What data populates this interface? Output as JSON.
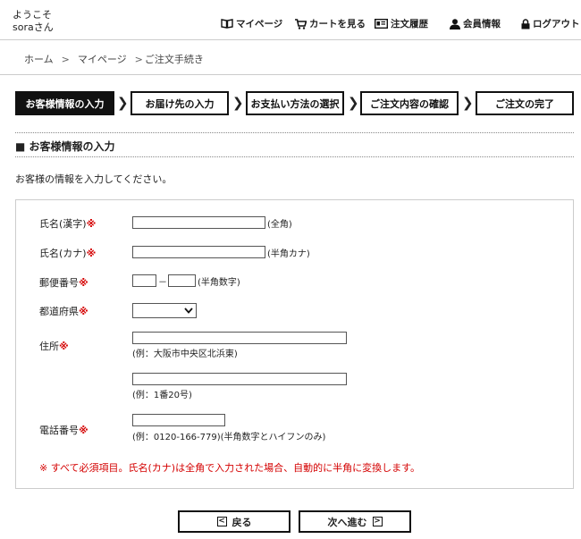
{
  "header": {
    "welcome_line1": "ようこそ",
    "welcome_line2": "soraさん",
    "nav": {
      "mypage": "マイページ",
      "cart": "カートを見る",
      "history": "注文履歴",
      "member": "会員情報",
      "logout": "ログアウト"
    }
  },
  "breadcrumb": {
    "home": "ホーム",
    "mypage": "マイページ",
    "current": "ご注文手続き"
  },
  "steps": [
    "お客様情報の入力",
    "お届け先の入力",
    "お支払い方法の選択",
    "ご注文内容の確認",
    "ご注文の完了"
  ],
  "section": {
    "title": "お客様情報の入力",
    "intro": "お客様の情報を入力してください。"
  },
  "form": {
    "required_mark": "※",
    "name_kanji": {
      "label": "氏名(漢字)",
      "hint": "(全角)"
    },
    "name_kana": {
      "label": "氏名(カナ)",
      "hint": "(半角カナ)"
    },
    "zip": {
      "label": "郵便番号",
      "dash": "－",
      "hint": "(半角数字)"
    },
    "prefecture": {
      "label": "都道府県"
    },
    "address": {
      "label": "住所",
      "hint1": "(例：大阪市中央区北浜東)",
      "hint2": "(例：1番20号)"
    },
    "phone": {
      "label": "電話番号",
      "hint": "(例：0120-166-779)(半角数字とハイフンのみ)"
    },
    "note": "※ すべて必須項目。氏名(カナ)は全角で入力された場合、自動的に半角に変換します。"
  },
  "buttons": {
    "back": "戻る",
    "next": "次へ進む"
  }
}
